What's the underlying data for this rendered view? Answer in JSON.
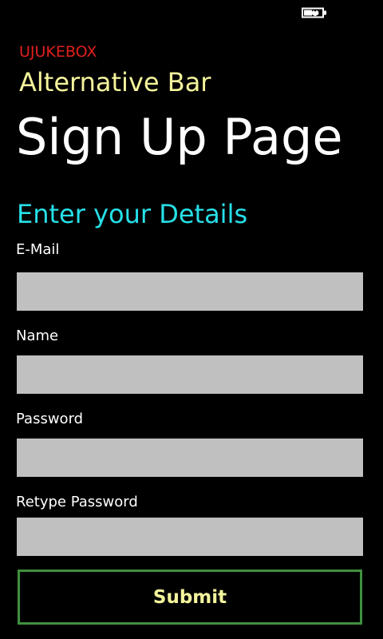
{
  "status_bar": {
    "battery_icon": "battery-charging-icon"
  },
  "header": {
    "app_name": "UJUKEBOX",
    "subtitle": "Alternative Bar",
    "page_title": "Sign Up Page"
  },
  "form": {
    "heading": "Enter your Details",
    "fields": [
      {
        "label": "E-Mail",
        "value": ""
      },
      {
        "label": "Name",
        "value": ""
      },
      {
        "label": "Password",
        "value": ""
      },
      {
        "label": "Retype Password",
        "value": ""
      }
    ],
    "submit_label": "Submit"
  },
  "colors": {
    "background": "#000000",
    "app_name": "#e0201e",
    "subtitle": "#f4f49c",
    "page_title": "#ffffff",
    "section_heading": "#26e0e8",
    "field_label": "#ffffff",
    "field_background": "#c0c0c0",
    "button_border": "#3f9140",
    "button_text": "#f4f49c"
  }
}
